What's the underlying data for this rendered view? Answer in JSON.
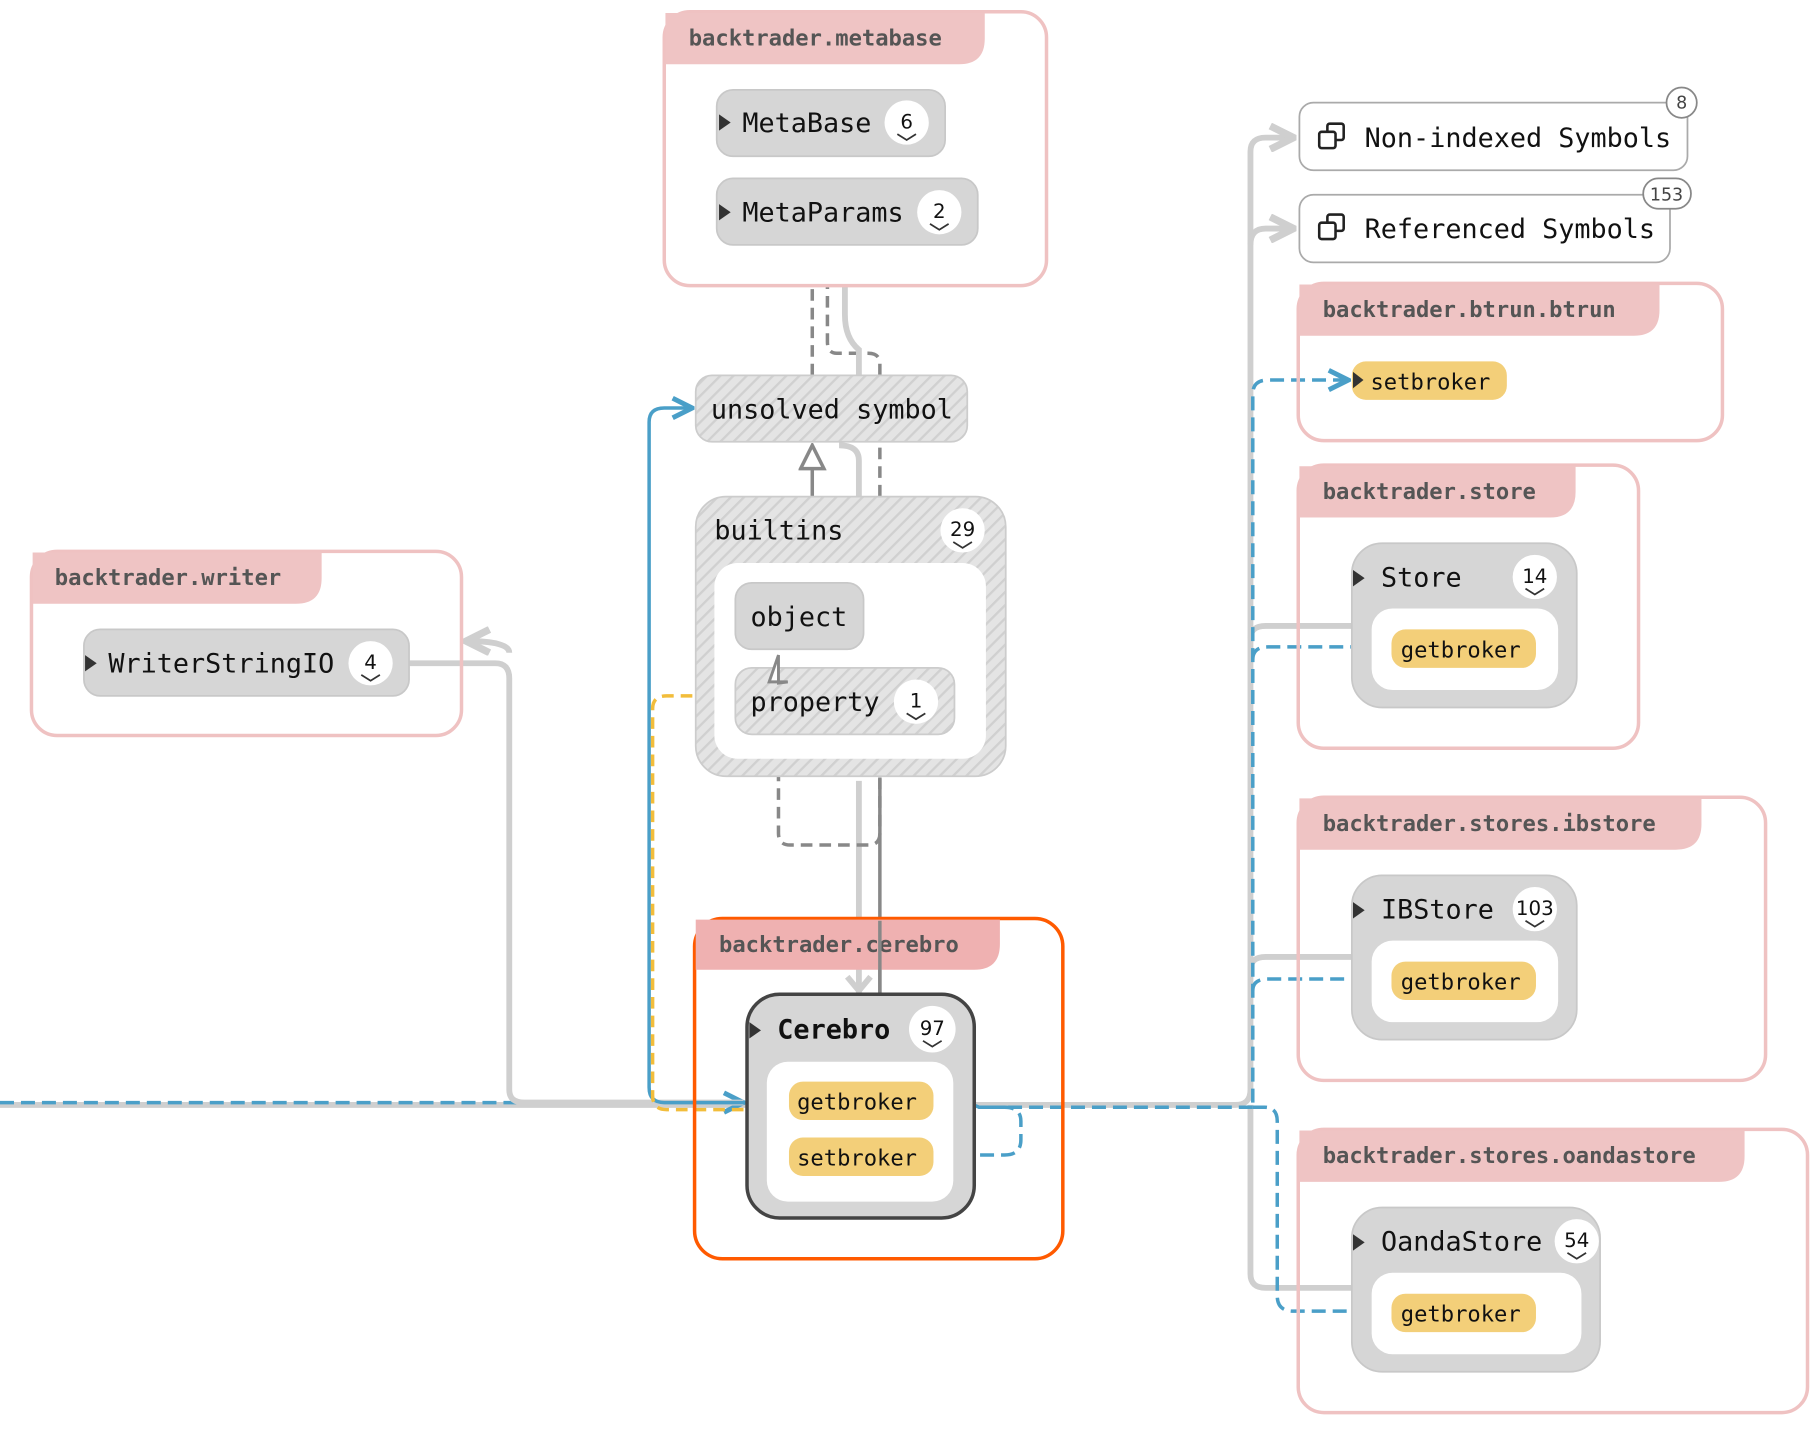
{
  "colors": {
    "group_border": "#efc2c2",
    "group_tab": "#efc4c4",
    "focus_border": "#ff5a00",
    "node": "#d6d6d6",
    "member": "#f3cf79",
    "call_edge": "#4a9fc8",
    "property_edge": "#f2bd3b"
  },
  "summary": {
    "non_indexed": {
      "label": "Non-indexed Symbols",
      "count": "8",
      "icon": "copy-icon"
    },
    "referenced": {
      "label": "Referenced Symbols",
      "count": "153",
      "icon": "copy-icon"
    }
  },
  "groups": {
    "metabase": {
      "label": "backtrader.metabase",
      "nodes": [
        {
          "name": "MetaBase",
          "count": "6"
        },
        {
          "name": "MetaParams",
          "count": "2"
        }
      ]
    },
    "unsolved": {
      "label": "unsolved symbol"
    },
    "builtins": {
      "label": "builtins",
      "count": "29",
      "members": [
        {
          "name": "object"
        },
        {
          "name": "property",
          "count": "1"
        }
      ]
    },
    "writer": {
      "label": "backtrader.writer",
      "node": {
        "name": "WriterStringIO",
        "count": "4"
      }
    },
    "cerebro": {
      "label": "backtrader.cerebro",
      "node": {
        "name": "Cerebro",
        "count": "97",
        "members": [
          "getbroker",
          "setbroker"
        ]
      }
    },
    "btrun": {
      "label": "backtrader.btrun.btrun",
      "member": "setbroker"
    },
    "store": {
      "label": "backtrader.store",
      "node": {
        "name": "Store",
        "count": "14",
        "member": "getbroker"
      }
    },
    "ibstore": {
      "label": "backtrader.stores.ibstore",
      "node": {
        "name": "IBStore",
        "count": "103",
        "member": "getbroker"
      }
    },
    "oandastore": {
      "label": "backtrader.stores.oandastore",
      "node": {
        "name": "OandaStore",
        "count": "54",
        "member": "getbroker"
      }
    }
  }
}
